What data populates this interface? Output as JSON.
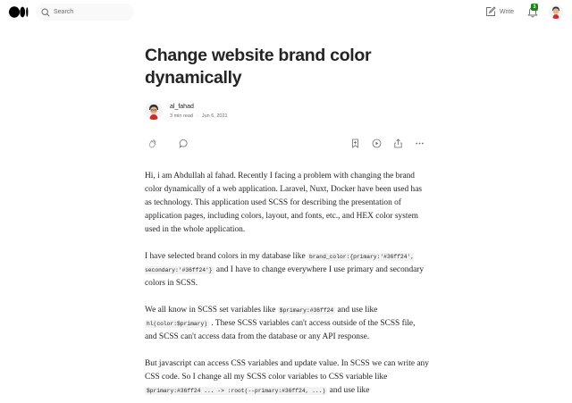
{
  "header": {
    "search_placeholder": "Search",
    "write_label": "Write",
    "notification_count": "3"
  },
  "article": {
    "title": "Change website brand color dynamically",
    "author": "al_fahad",
    "read_time": "3 min read",
    "date": "Jun 6, 2021",
    "p1": "Hi, i am Abdullah al fahad. Recently I facing a problem with changing the brand color dynamically of a web application. Laravel, Nuxt, Docker have been used has as technology. This application used SCSS for describing the presentation of application pages, including colors, layout, and fonts, etc., and HEX color system used in the whole application.",
    "p2_a": "I have selected brand colors in my database like ",
    "p2_code": "brand_color:{primary:'#36ff24', secondary:'#36ff24'}",
    "p2_b": " and I have to change everywhere I use primary and secondary colors in SCSS.",
    "p3_a": "We all know in SCSS set variables like ",
    "p3_code1": "$primary:#36ff24",
    "p3_b": " and use like ",
    "p3_code2": "hl(color:$primary)",
    "p3_c": " . These SCSS variables can't access outside of the SCSS file, and SCSS can't access data from the database or any API response.",
    "p4_a": "But javascript can access CSS variables and update value. In SCSS we can write any CSS code. So I change all my SCSS color variables to CSS variable like ",
    "p4_code": "$primary:#36ff24 ... -> :root(--primary:#36ff24, ...)",
    "p4_b": " and use like"
  },
  "icons": {
    "logo": "medium-logo",
    "search": "search-icon",
    "write": "write-icon",
    "notifications": "bell-icon",
    "clap": "clap-icon",
    "comment": "comment-icon",
    "save": "bookmark-add-icon",
    "listen": "play-icon",
    "share": "share-icon",
    "more": "more-icon"
  }
}
